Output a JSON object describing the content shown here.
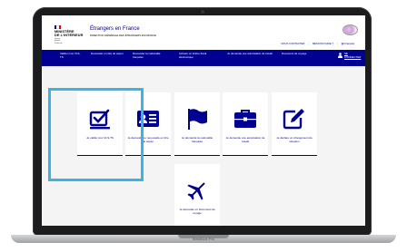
{
  "base_label": "MacBook Pro",
  "header": {
    "ministry_lines": [
      "MINISTÈRE",
      "DE L'INTÉRIEUR"
    ],
    "motto_lines": [
      "Liberté",
      "Égalité",
      "Fraternité"
    ],
    "site_title": "Étrangers en France",
    "site_subtitle": "DIRECTION GÉNÉRALE DES ÉTRANGERS EN FRANCE",
    "links": [
      "NOUS CONTACTER",
      "BESOIN D'AIDE ?",
      "Français"
    ]
  },
  "nav": {
    "active": "Accueil",
    "items": [
      "Valider mon VLS-TS",
      "Demander un titre de séjour",
      "Demander la nationalité française",
      "Acheter un timbre fiscal électronique",
      "Je demande une autorisation de travail",
      "Document de voyage"
    ],
    "user": "SE CONNECTER"
  },
  "tiles": [
    {
      "label": "Je valide mon VLS-TS",
      "icon": "check-form-icon"
    },
    {
      "label": "Je demande ou renouvelle un titre de séjour",
      "icon": "id-card-icon"
    },
    {
      "label": "Je demande la nationalité française",
      "icon": "flag-icon"
    },
    {
      "label": "Je demande une autorisation de travail",
      "icon": "briefcase-icon"
    },
    {
      "label": "Je déclare un changement de situation",
      "icon": "edit-icon"
    },
    {
      "label": "Je demande un Document de voyage",
      "icon": "airplane-icon"
    }
  ],
  "colors": {
    "brand": "#000091",
    "highlight": "#3bb3e6",
    "background": "#f4f4f4"
  }
}
